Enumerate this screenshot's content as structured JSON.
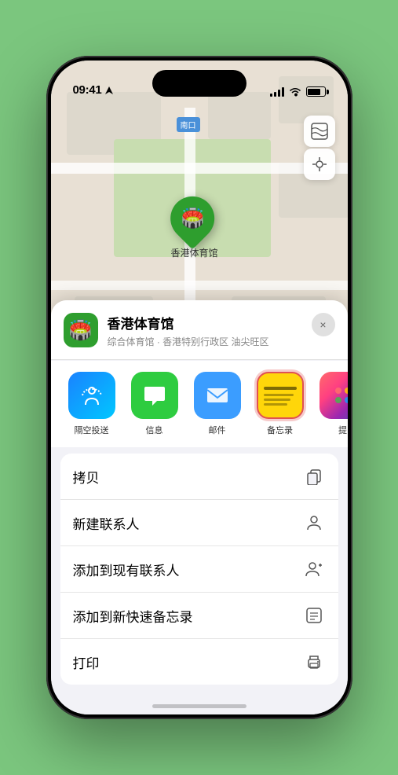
{
  "status_bar": {
    "time": "09:41",
    "location_arrow": "▶"
  },
  "map": {
    "label": "南口",
    "marker_label": "香港体育馆"
  },
  "location_header": {
    "name": "香港体育馆",
    "subtitle": "综合体育馆 · 香港特别行政区 油尖旺区",
    "close_label": "×"
  },
  "share_apps": [
    {
      "id": "airdrop",
      "label": "隔空投送",
      "icon": "📡"
    },
    {
      "id": "messages",
      "label": "信息",
      "icon": "💬"
    },
    {
      "id": "mail",
      "label": "邮件",
      "icon": "✉️"
    },
    {
      "id": "notes",
      "label": "备忘录",
      "icon": ""
    },
    {
      "id": "more",
      "label": "提",
      "icon": "⋯"
    }
  ],
  "actions": [
    {
      "id": "copy",
      "label": "拷贝",
      "icon": "⧉"
    },
    {
      "id": "new-contact",
      "label": "新建联系人",
      "icon": "👤"
    },
    {
      "id": "add-existing",
      "label": "添加到现有联系人",
      "icon": "👤+"
    },
    {
      "id": "add-notes",
      "label": "添加到新快速备忘录",
      "icon": "📋"
    },
    {
      "id": "print",
      "label": "打印",
      "icon": "🖨️"
    }
  ]
}
